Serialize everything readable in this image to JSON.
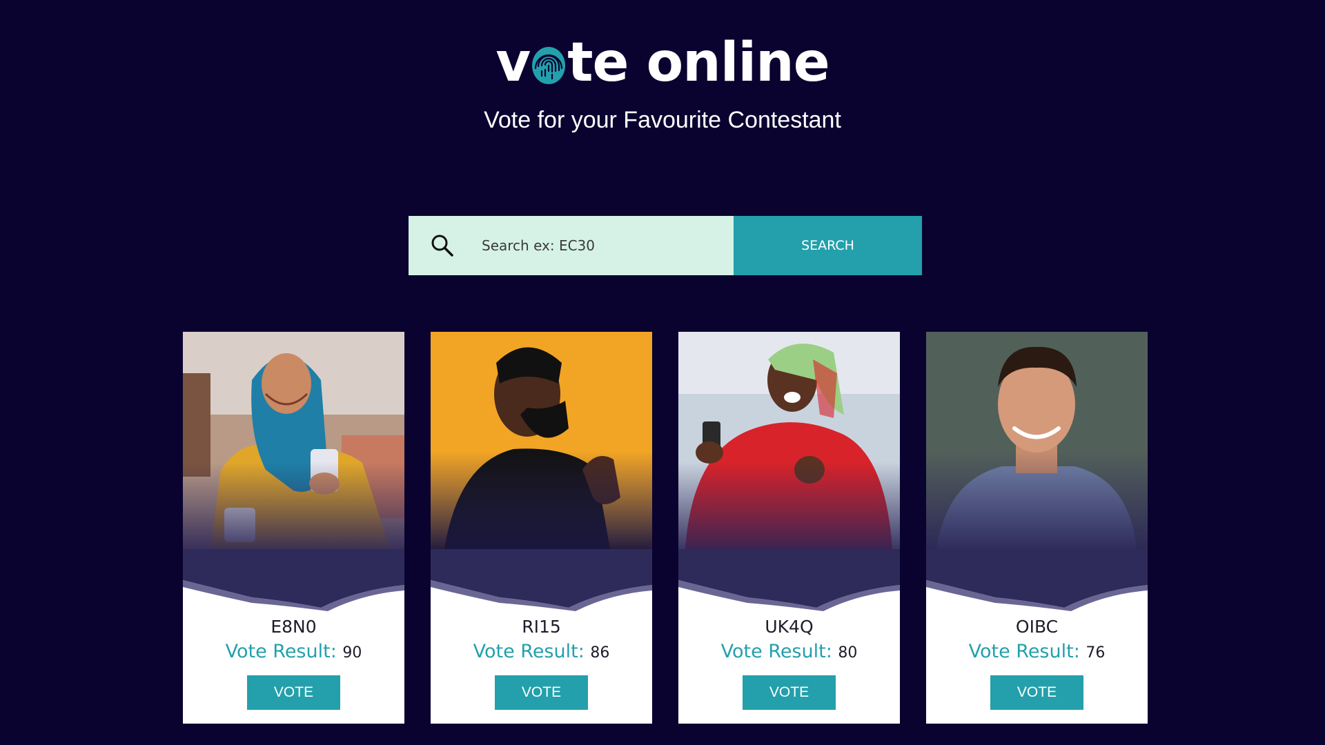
{
  "brand": {
    "logo_prefix": "v",
    "logo_suffix": "te online",
    "logo_icon": "fingerprint-icon",
    "tagline": "Vote for your Favourite Contestant"
  },
  "search": {
    "placeholder": "Search ex: EC30",
    "button_label": "SEARCH",
    "icon": "search-icon"
  },
  "contestants": [
    {
      "code": "E8N0",
      "result_label": "Vote Result:",
      "result_value": "90",
      "button_label": "VOTE"
    },
    {
      "code": "RI15",
      "result_label": "Vote Result:",
      "result_value": "86",
      "button_label": "VOTE"
    },
    {
      "code": "UK4Q",
      "result_label": "Vote Result:",
      "result_value": "80",
      "button_label": "VOTE"
    },
    {
      "code": "OIBC",
      "result_label": "Vote Result:",
      "result_value": "76",
      "button_label": "VOTE"
    }
  ],
  "colors": {
    "background": "#0a0330",
    "accent": "#23a0ab",
    "search_field": "#d6f2e6",
    "wave": "#2e2a5a"
  }
}
